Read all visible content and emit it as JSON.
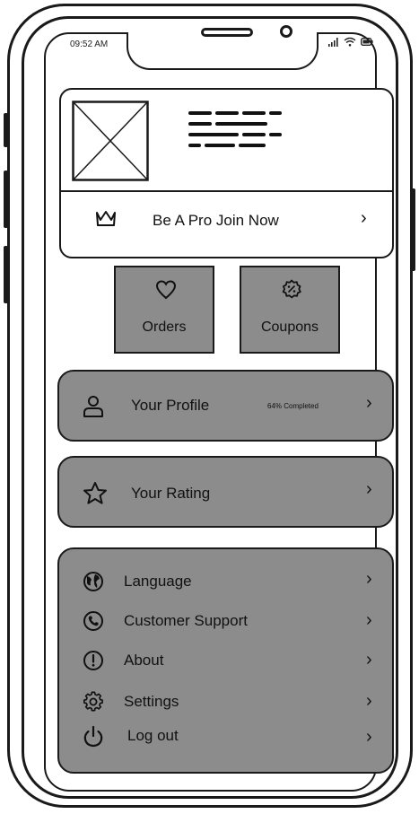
{
  "status_bar": {
    "time": "09:52 AM"
  },
  "pro_card": {
    "cta_label": "Be A Pro Join Now"
  },
  "quick_actions": [
    {
      "label": "Orders",
      "icon": "heart-icon"
    },
    {
      "label": "Coupons",
      "icon": "coupon-icon"
    }
  ],
  "profile_row": {
    "label": "Your Profile",
    "completion": "64% Completed"
  },
  "rating_row": {
    "label": "Your Rating"
  },
  "settings_list": [
    {
      "label": "Language",
      "icon": "globe-icon"
    },
    {
      "label": "Customer Support",
      "icon": "phone-icon"
    },
    {
      "label": "About",
      "icon": "info-icon"
    },
    {
      "label": "Settings",
      "icon": "gear-icon"
    },
    {
      "label": "Log out",
      "icon": "power-icon"
    }
  ],
  "colors": {
    "panel": "#8c8c8c",
    "outline": "#1a1a1a",
    "background": "#ffffff"
  }
}
